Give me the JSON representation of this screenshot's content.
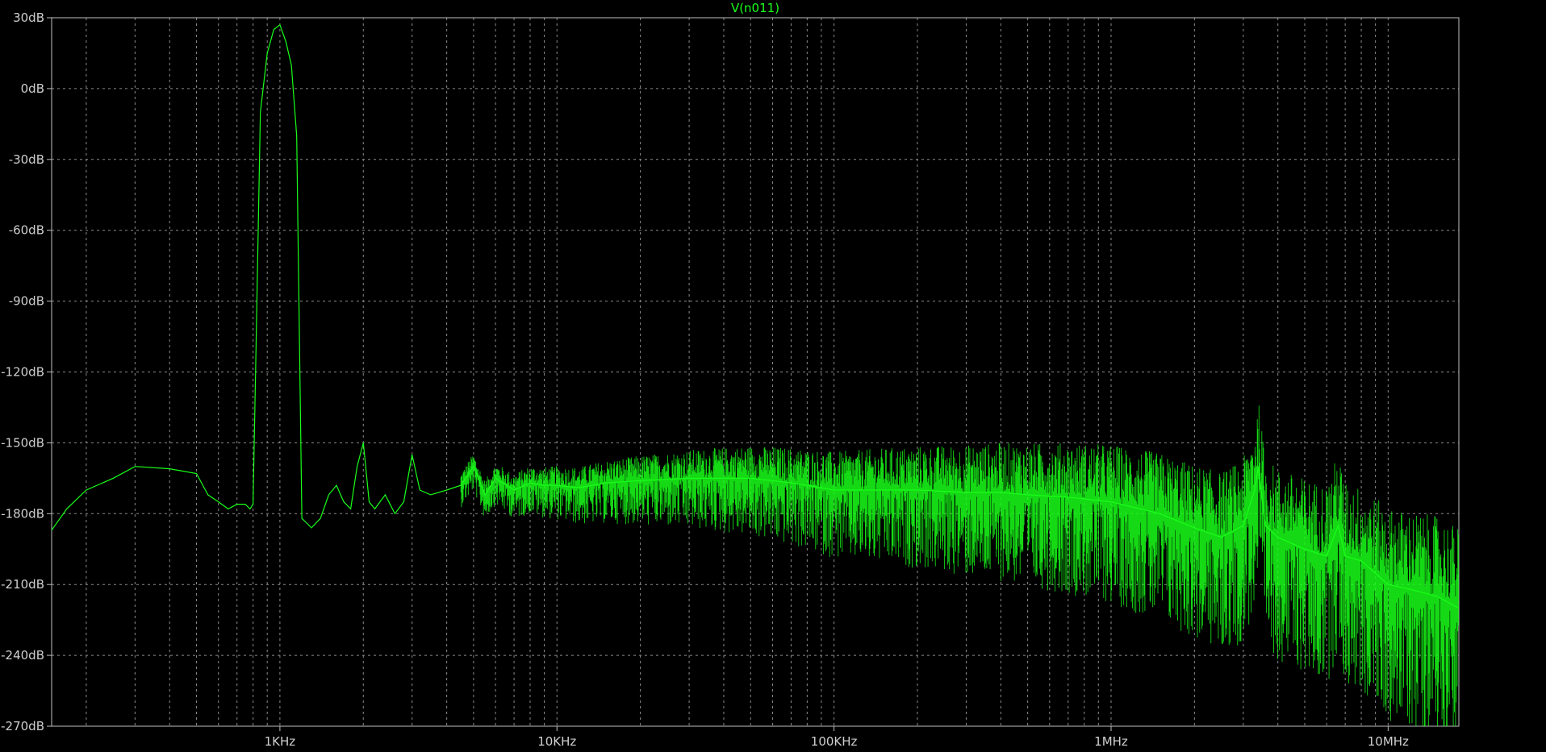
{
  "chart_data": {
    "type": "line",
    "title": "V(n011)",
    "xlabel": "",
    "ylabel": "",
    "xscale": "log",
    "xlim": [
      150,
      18000000
    ],
    "ylim": [
      -270,
      30
    ],
    "grid": true,
    "x_ticks": [
      1000,
      10000,
      100000,
      1000000,
      10000000
    ],
    "x_tick_labels": [
      "1KHz",
      "10KHz",
      "100KHz",
      "1MHz",
      "10MHz"
    ],
    "y_ticks": [
      30,
      0,
      -30,
      -60,
      -90,
      -120,
      -150,
      -180,
      -210,
      -240,
      -270
    ],
    "y_tick_labels": [
      "30dB",
      "0dB",
      "-30dB",
      "-60dB",
      "-90dB",
      "-120dB",
      "-150dB",
      "-180dB",
      "-210dB",
      "-240dB",
      "-270dB"
    ],
    "colors": {
      "background": "#000000",
      "grid": "#8c8c8c",
      "trace": "#19ff19",
      "axis_text": "#cfcfcf"
    },
    "series": [
      {
        "name": "V(n011)",
        "x": [
          150,
          170,
          200,
          250,
          300,
          400,
          500,
          550,
          600,
          650,
          700,
          750,
          780,
          800,
          820,
          850,
          900,
          950,
          1000,
          1050,
          1100,
          1150,
          1200,
          1250,
          1300,
          1400,
          1500,
          1600,
          1700,
          1800,
          1900,
          2000,
          2100,
          2200,
          2400,
          2600,
          2800,
          3000,
          3200,
          3500,
          4000,
          4500,
          5000,
          5500,
          6000,
          7000,
          8000,
          9000,
          10000,
          12000,
          15000,
          20000,
          30000,
          40000,
          50000,
          60000,
          70000,
          80000,
          100000,
          150000,
          200000,
          300000,
          400000,
          500000,
          700000,
          1000000,
          1500000,
          2000000,
          2500000,
          3000000,
          3300000,
          3400000,
          3600000,
          4000000,
          5000000,
          6000000,
          6600000,
          7000000,
          8000000,
          10000000,
          12000000,
          15000000,
          18000000
        ],
        "values": [
          -187,
          -178,
          -170,
          -165,
          -160,
          -161,
          -163,
          -172,
          -175,
          -178,
          -176,
          -176,
          -178,
          -176,
          -110,
          -10,
          15,
          25,
          27,
          20,
          10,
          -20,
          -182,
          -184,
          -186,
          -182,
          -172,
          -168,
          -175,
          -178,
          -160,
          -150,
          -175,
          -178,
          -172,
          -180,
          -175,
          -155,
          -170,
          -172,
          -170,
          -168,
          -160,
          -172,
          -165,
          -170,
          -167,
          -168,
          -168,
          -169,
          -167,
          -166,
          -165,
          -165,
          -165,
          -166,
          -167,
          -168,
          -170,
          -170,
          -170,
          -171,
          -171,
          -172,
          -173,
          -175,
          -180,
          -186,
          -190,
          -185,
          -170,
          -160,
          -185,
          -190,
          -195,
          -198,
          -185,
          -198,
          -200,
          -210,
          -212,
          -215,
          -220
        ]
      }
    ]
  }
}
